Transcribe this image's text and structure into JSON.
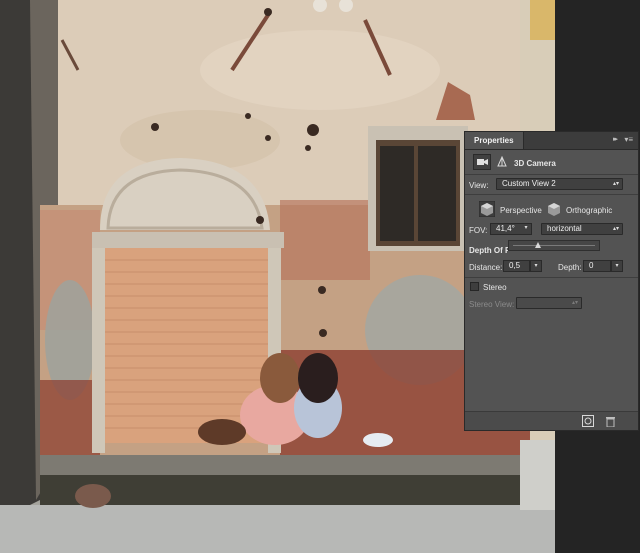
{
  "panel": {
    "tab_title": "Properties",
    "collapse_glyph": "▸▸",
    "menu_glyph": "▾≡",
    "camera_title": "3D Camera",
    "view_label": "View:",
    "view_value": "Custom View 2",
    "perspective_label": "Perspective",
    "orthographic_label": "Orthographic",
    "fov_label": "FOV:",
    "fov_value": "41,4°",
    "fov_unit": "horizontal",
    "depth_of_field_label": "Depth Of F",
    "distance_label": "Distance:",
    "distance_value": "0,5",
    "depth_label": "Depth:",
    "depth_value": "0",
    "stereo_label": "Stereo",
    "stereo_view_label": "Stereo View:",
    "stereo_view_value": "",
    "dof_slider_value": 0.3
  },
  "icons": {
    "camera": "camera-icon",
    "scene": "3d-scene-icon",
    "perspective": "perspective-cube-icon",
    "orthographic": "orthographic-cube-icon",
    "render": "render-icon",
    "trash": "trash-icon"
  },
  "colors": {
    "panel_bg": "#535353",
    "field_bg": "#404040",
    "tab_bar": "#3c3c3c"
  }
}
